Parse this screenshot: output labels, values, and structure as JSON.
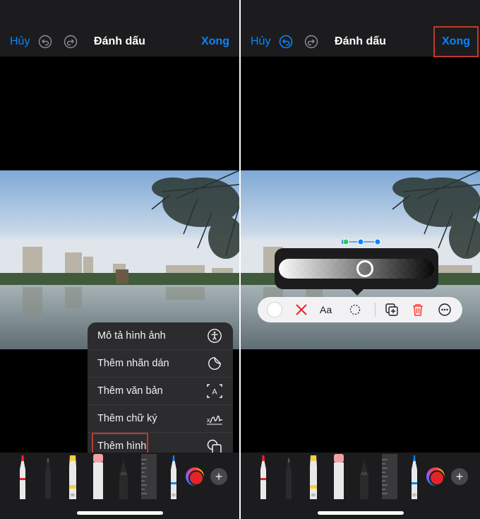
{
  "left_screen": {
    "nav": {
      "cancel": "Hủy",
      "title": "Đánh dấu",
      "done": "Xong"
    },
    "menu": {
      "items": [
        {
          "label": "Mô tả hình ảnh",
          "icon": "accessibility-icon"
        },
        {
          "label": "Thêm nhãn dán",
          "icon": "sticker-icon"
        },
        {
          "label": "Thêm văn bản",
          "icon": "text-box-icon"
        },
        {
          "label": "Thêm chữ ký",
          "icon": "signature-icon"
        },
        {
          "label": "Thêm hình",
          "icon": "shapes-icon"
        }
      ],
      "highlighted": "Thêm hình"
    },
    "text_box_icon_letter": "A",
    "signature_icon_letter": "x"
  },
  "right_screen": {
    "nav": {
      "cancel": "Hủy",
      "title": "Đánh dấu",
      "done": "Xong"
    },
    "opacity": 0.55,
    "shape_toolbar": {
      "text_style": "Aa"
    }
  },
  "toolbar": {
    "tools": [
      "pen",
      "marker",
      "highlighter",
      "eraser",
      "pencil",
      "ruler",
      "blue-pen"
    ],
    "marker_width": "80",
    "blue_pen_width": "50",
    "add_symbol": "+"
  },
  "colors": {
    "accent": "#0a84ff",
    "highlight_box": "#c0392b",
    "selected_color": "#e5242a",
    "delete_red": "#ff3b30"
  }
}
